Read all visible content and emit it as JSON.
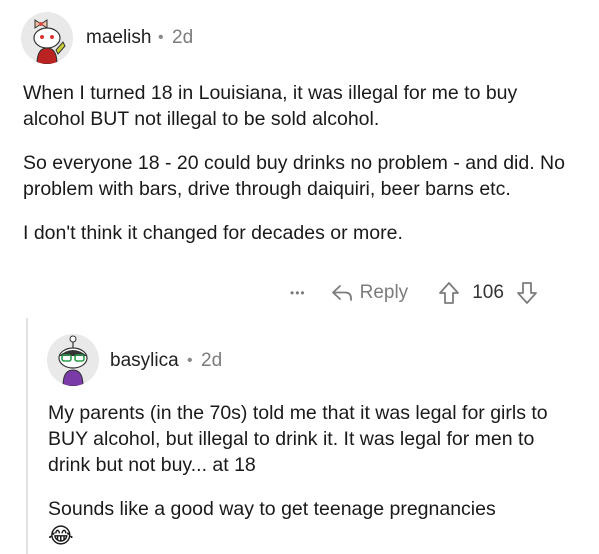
{
  "comment1": {
    "username": "maelish",
    "separator": "•",
    "age": "2d",
    "paragraphs": [
      "When I turned 18 in Louisiana, it was illegal for me to buy alcohol BUT not illegal to be sold alcohol.",
      "So everyone 18 - 20 could buy drinks no problem - and did.  No problem with bars, drive through daiquiri, beer barns etc.",
      "I don't think it changed for decades or more."
    ],
    "more_label": "•••",
    "reply_label": "Reply",
    "score": "106"
  },
  "comment2": {
    "username": "basylica",
    "separator": "•",
    "age": "2d",
    "paragraphs": [
      "My parents (in the 70s) told me that it was legal for girls to BUY alcohol, but illegal to drink it. It was legal for men to drink but not buy... at 18",
      "Sounds like a good way to get teenage pregnancies"
    ],
    "emoji": "😂"
  },
  "icons": {
    "more": "more-icon",
    "reply": "reply-arrow-icon",
    "upvote": "upvote-arrow-icon",
    "downvote": "downvote-arrow-icon"
  },
  "colors": {
    "meta_gray": "#7c7c7c",
    "thread_line": "#e2e2e2"
  }
}
